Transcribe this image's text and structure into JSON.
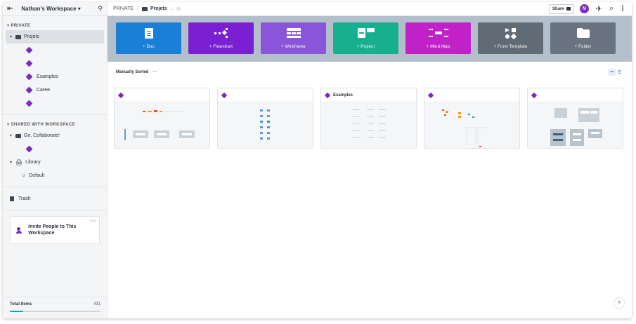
{
  "workspace": {
    "name": "Nathan's Workspace ▾"
  },
  "sidebar": {
    "private_label": "▾ PRIVATE",
    "projets_label": "Projets",
    "items": [
      "",
      "",
      "Examples",
      "Caree",
      ""
    ],
    "shared_label": "▾ SHARED WITH WORKSPACE",
    "collab_label": "Go, Collaborate!",
    "library_label": "Library",
    "default_label": "Default",
    "trash_label": "Trash",
    "invite": {
      "hide": "HIDE",
      "text": "Invite People to This Workspace"
    },
    "total": {
      "label": "Total Items",
      "count": "431",
      "progress": 0.15
    }
  },
  "breadcrumb": {
    "root": "PRIVATE",
    "current": "Projets"
  },
  "topbar": {
    "share": "Share",
    "avatar": "N"
  },
  "create_tiles": [
    {
      "label": "+ Doc",
      "color": "#1a7fd6"
    },
    {
      "label": "+ Flowchart",
      "color": "#7a1fd1"
    },
    {
      "label": "+ Wireframe",
      "color": "#8a55d8"
    },
    {
      "label": "+ Project",
      "color": "#17b08f"
    },
    {
      "label": "+ Mind Map",
      "color": "#c022c8"
    },
    {
      "label": "+ From Template",
      "color": "#616b76"
    },
    {
      "label": "+ Folder",
      "color": "#6a7480"
    }
  ],
  "sort": {
    "label": "Manually Sorted",
    "more": "···"
  },
  "cards": [
    {
      "title": ""
    },
    {
      "title": ""
    },
    {
      "title": "Examples"
    },
    {
      "title": ""
    },
    {
      "title": ""
    }
  ],
  "help": "?"
}
